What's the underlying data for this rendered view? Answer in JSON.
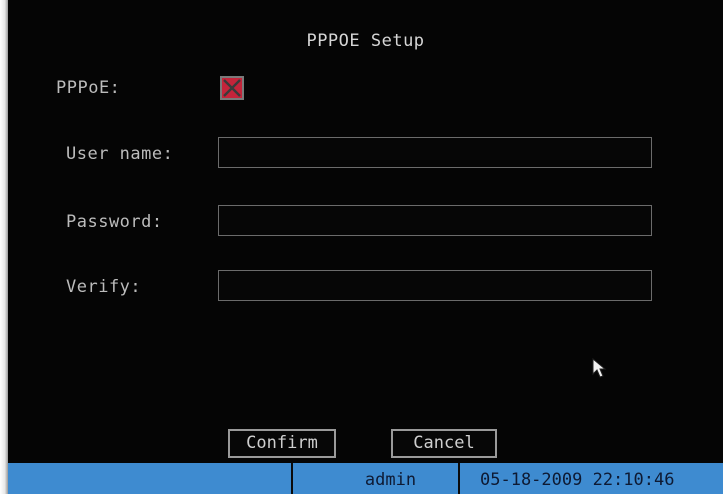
{
  "dialog": {
    "title": "PPPOE Setup"
  },
  "form": {
    "pppoe_label": "PPPoE:",
    "pppoe_checked": false,
    "username_label": "User name:",
    "username_value": "",
    "password_label": "Password:",
    "password_value": "",
    "verify_label": "Verify:",
    "verify_value": ""
  },
  "buttons": {
    "confirm_label": "Confirm",
    "cancel_label": "Cancel"
  },
  "statusbar": {
    "user": "admin",
    "datetime": "05-18-2009 22:10:46",
    "color": "#3e8bd0"
  },
  "colors": {
    "background": "#050505",
    "checkbox_fill": "#c4243a",
    "text": "#bcbcbc"
  },
  "icons": {
    "checkbox_mark": "x-mark-icon",
    "pointer": "mouse-pointer-icon"
  }
}
